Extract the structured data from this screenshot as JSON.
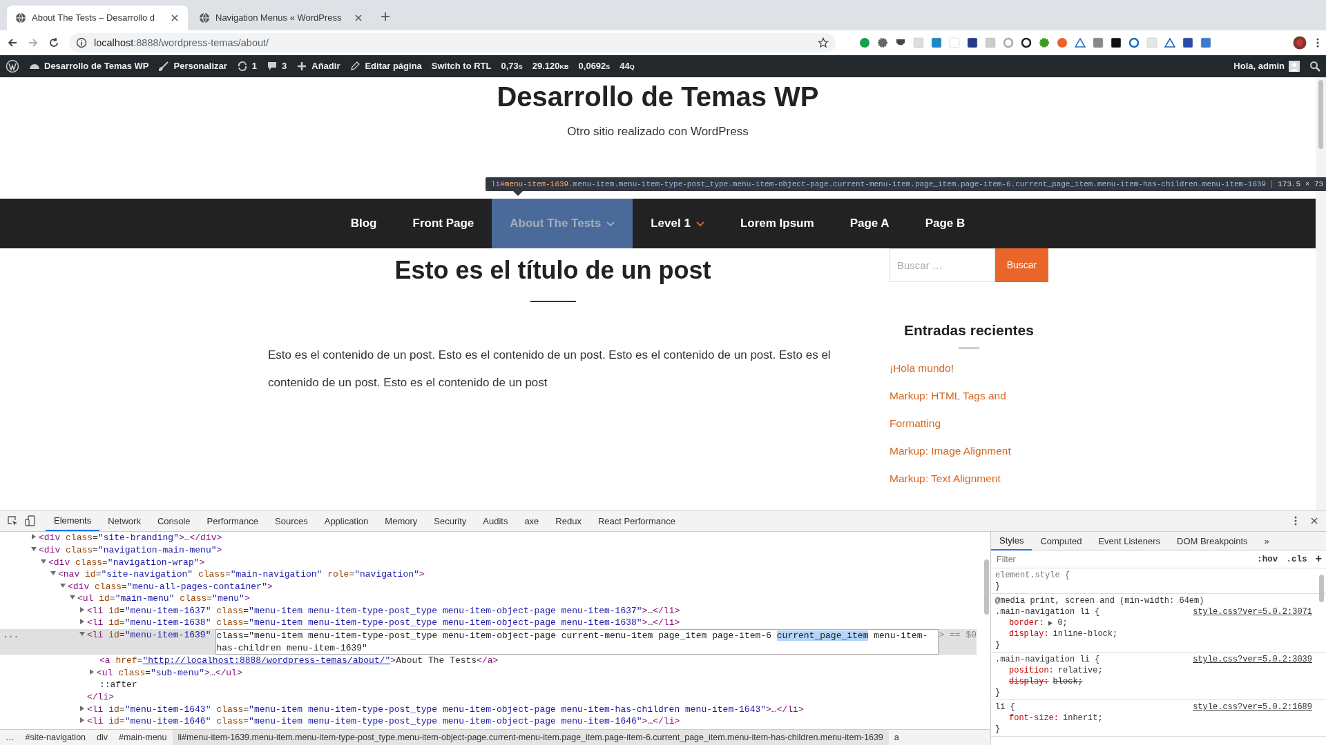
{
  "browser": {
    "tabs": [
      {
        "title": "About The Tests – Desarrollo d",
        "selected": true
      },
      {
        "title": "Navigation Menus « WordPress",
        "selected": false
      }
    ],
    "url_host": "localhost",
    "url_rest": ":8888/wordpress-temas/about/"
  },
  "admin_bar": {
    "site": "Desarrollo de Temas WP",
    "customize": "Personalizar",
    "updates": "1",
    "comments": "3",
    "new": "Añadir",
    "edit": "Editar página",
    "rtl": "Switch to RTL",
    "stats": [
      "0,73s",
      "29.120kb",
      "0,0692s",
      "44q"
    ],
    "greeting": "Hola, admin"
  },
  "site": {
    "title": "Desarrollo de Temas WP",
    "tagline": "Otro sitio realizado con WordPress"
  },
  "inspect_tooltip": {
    "tag": "li",
    "id": "#menu-item-1639",
    "classes": ".menu-item.menu-item-type-post_type.menu-item-object-page.current-menu-item.page_item.page-item-6.current_page_item.menu-item-has-children.menu-item-1639",
    "size": "173.5 × 73"
  },
  "nav": [
    {
      "label": "Blog",
      "selected": false,
      "has_submenu": false
    },
    {
      "label": "Front Page",
      "selected": false,
      "has_submenu": false
    },
    {
      "label": "About The Tests",
      "selected": true,
      "has_submenu": true
    },
    {
      "label": "Level 1",
      "selected": false,
      "has_submenu": true
    },
    {
      "label": "Lorem Ipsum",
      "selected": false,
      "has_submenu": false
    },
    {
      "label": "Page A",
      "selected": false,
      "has_submenu": false
    },
    {
      "label": "Page B",
      "selected": false,
      "has_submenu": false
    }
  ],
  "post": {
    "title": "Esto es el título de un post",
    "body": "Esto es el contenido de un post. Esto es el contenido de un post. Esto es el contenido de un post. Esto es el contenido de un post. Esto es el contenido de un post"
  },
  "sidebar": {
    "search_placeholder": "Buscar …",
    "search_button": "Buscar",
    "heading": "Entradas recientes",
    "links": [
      "¡Hola mundo!",
      "Markup: HTML Tags and Formatting",
      "Markup: Image Alignment",
      "Markup: Text Alignment"
    ]
  },
  "devtools": {
    "tabs": [
      {
        "label": "Elements",
        "selected": true
      },
      {
        "label": "Network",
        "selected": false
      },
      {
        "label": "Console",
        "selected": false
      },
      {
        "label": "Performance",
        "selected": false
      },
      {
        "label": "Sources",
        "selected": false
      },
      {
        "label": "Application",
        "selected": false
      },
      {
        "label": "Memory",
        "selected": false
      },
      {
        "label": "Security",
        "selected": false
      },
      {
        "label": "Audits",
        "selected": false
      },
      {
        "label": "axe",
        "selected": false
      },
      {
        "label": "Redux",
        "selected": false
      },
      {
        "label": "React Performance",
        "selected": false
      }
    ],
    "dom_tree": [
      {
        "kind": "element",
        "expanded": false,
        "text": "<div class=\"site-branding\">…</div>"
      },
      {
        "kind": "element",
        "expanded": true,
        "text": "<div class=\"navigation-main-menu\">",
        "children": [
          {
            "kind": "element",
            "expanded": true,
            "text": "<div class=\"navigation-wrap\">",
            "children": [
              {
                "kind": "element",
                "expanded": true,
                "text": "<nav id=\"site-navigation\" class=\"main-navigation\" role=\"navigation\">",
                "children": [
                  {
                    "kind": "element",
                    "expanded": true,
                    "text": "<div class=\"menu-all-pages-container\">",
                    "children": [
                      {
                        "kind": "element",
                        "expanded": true,
                        "text": "<ul id=\"main-menu\" class=\"menu\">",
                        "children": [
                          {
                            "kind": "element",
                            "expanded": false,
                            "text": "<li id=\"menu-item-1637\" class=\"menu-item menu-item-type-post_type menu-item-object-page menu-item-1637\">…</li>"
                          },
                          {
                            "kind": "element",
                            "expanded": false,
                            "text": "<li id=\"menu-item-1638\" class=\"menu-item menu-item-type-post_type menu-item-object-page menu-item-1638\">…</li>"
                          },
                          {
                            "kind": "element",
                            "expanded": true,
                            "selected": true,
                            "gutter": "...",
                            "text": "<li id=\"menu-item-1639\"",
                            "editor": {
                              "before": "class=\"menu-item menu-item-type-post_type menu-item-object-page current-menu-item page_item page-item-6 ",
                              "selection": "current_page_item",
                              "after": " menu-item-has-children menu-item-1639\""
                            },
                            "suffix": "> == $0",
                            "close": "</li>",
                            "children": [
                              {
                                "kind": "leaf",
                                "link": true,
                                "text": "<a href=\"http://localhost:8888/wordpress-temas/about/\">About The Tests</a>"
                              },
                              {
                                "kind": "element",
                                "expanded": false,
                                "text": "<ul class=\"sub-menu\">…</ul>"
                              },
                              {
                                "kind": "leaf",
                                "text": "::after"
                              }
                            ]
                          },
                          {
                            "kind": "element",
                            "expanded": false,
                            "text": "<li id=\"menu-item-1643\" class=\"menu-item menu-item-type-post_type menu-item-object-page menu-item-has-children menu-item-1643\">…</li>"
                          },
                          {
                            "kind": "element",
                            "expanded": false,
                            "text": "<li id=\"menu-item-1646\" class=\"menu-item menu-item-type-post_type menu-item-object-page menu-item-1646\">…</li>"
                          }
                        ]
                      }
                    ]
                  }
                ]
              }
            ]
          }
        ]
      }
    ],
    "breadcrumbs": [
      {
        "label": "…",
        "selected": false
      },
      {
        "label": "#site-navigation",
        "selected": false
      },
      {
        "label": "div",
        "selected": false
      },
      {
        "label": "#main-menu",
        "selected": false
      },
      {
        "label": "li#menu-item-1639.menu-item.menu-item-type-post_type.menu-item-object-page.current-menu-item.page_item.page-item-6.current_page_item.menu-item-has-children.menu-item-1639",
        "selected": true
      },
      {
        "label": "a",
        "selected": false
      }
    ],
    "styles_tabs": [
      {
        "label": "Styles",
        "selected": true
      },
      {
        "label": "Computed",
        "selected": false
      },
      {
        "label": "Event Listeners",
        "selected": false
      },
      {
        "label": "DOM Breakpoints",
        "selected": false
      }
    ],
    "more_tabs": "»",
    "filter_placeholder": "Filter",
    "hov": ":hov",
    "cls": ".cls",
    "add": "+",
    "rules": [
      {
        "selector": "element.style {",
        "close": "}"
      },
      {
        "media": "@media print, screen and (min-width: 64em)",
        "selector": ".main-navigation li {",
        "source": "style.css?ver=5.0.2:3071",
        "declarations": [
          {
            "property": "border:",
            "value": "0;",
            "expander": true,
            "struck": false
          },
          {
            "property": "display:",
            "value": "inline-block;",
            "struck": false
          }
        ],
        "close": "}"
      },
      {
        "selector": ".main-navigation li {",
        "source": "style.css?ver=5.0.2:3039",
        "declarations": [
          {
            "property": "position:",
            "value": "relative;",
            "struck": false
          },
          {
            "property": "display:",
            "value": "block;",
            "struck": true
          }
        ],
        "close": "}"
      },
      {
        "selector": "li {",
        "source": "style.css?ver=5.0.2:1689",
        "declarations": [
          {
            "property": "font-size:",
            "value": "inherit;",
            "struck": false
          }
        ],
        "close": "}"
      }
    ]
  }
}
